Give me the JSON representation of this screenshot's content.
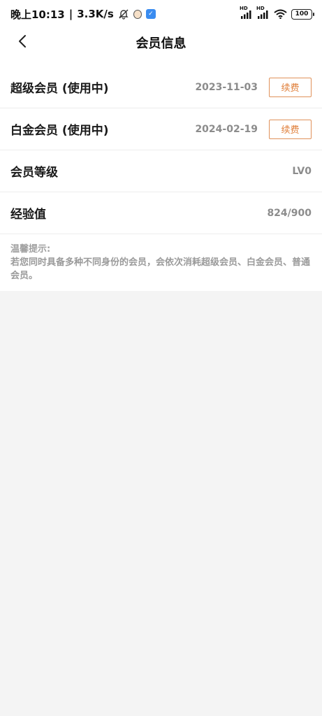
{
  "status_bar": {
    "time": "晚上10:13",
    "divider": "|",
    "speed": "3.3K/s",
    "battery": "100",
    "hd1": "HD",
    "hd2": "HD",
    "icons": [
      "bell-off-icon",
      "face-icon",
      "app-badge-icon",
      "signal-icon",
      "signal-icon",
      "wifi-icon",
      "battery-icon"
    ]
  },
  "header": {
    "title": "会员信息",
    "back_icon": "chevron-left-icon"
  },
  "members": [
    {
      "label": "超级会员 (使用中)",
      "value": "2023-11-03",
      "button": "续费"
    },
    {
      "label": "白金会员 (使用中)",
      "value": "2024-02-19",
      "button": "续费"
    },
    {
      "label": "会员等级",
      "value": "LV0"
    },
    {
      "label": "经验值",
      "value": "824/900"
    }
  ],
  "tips": {
    "title": "温馨提示:",
    "text": "若您同时具备多种不同身份的会员，会依次消耗超级会员、白金会员、普通会员。"
  },
  "colors": {
    "accent": "#e0803c",
    "background": "#f4f4f4",
    "value_gray": "#8c8c8c"
  }
}
